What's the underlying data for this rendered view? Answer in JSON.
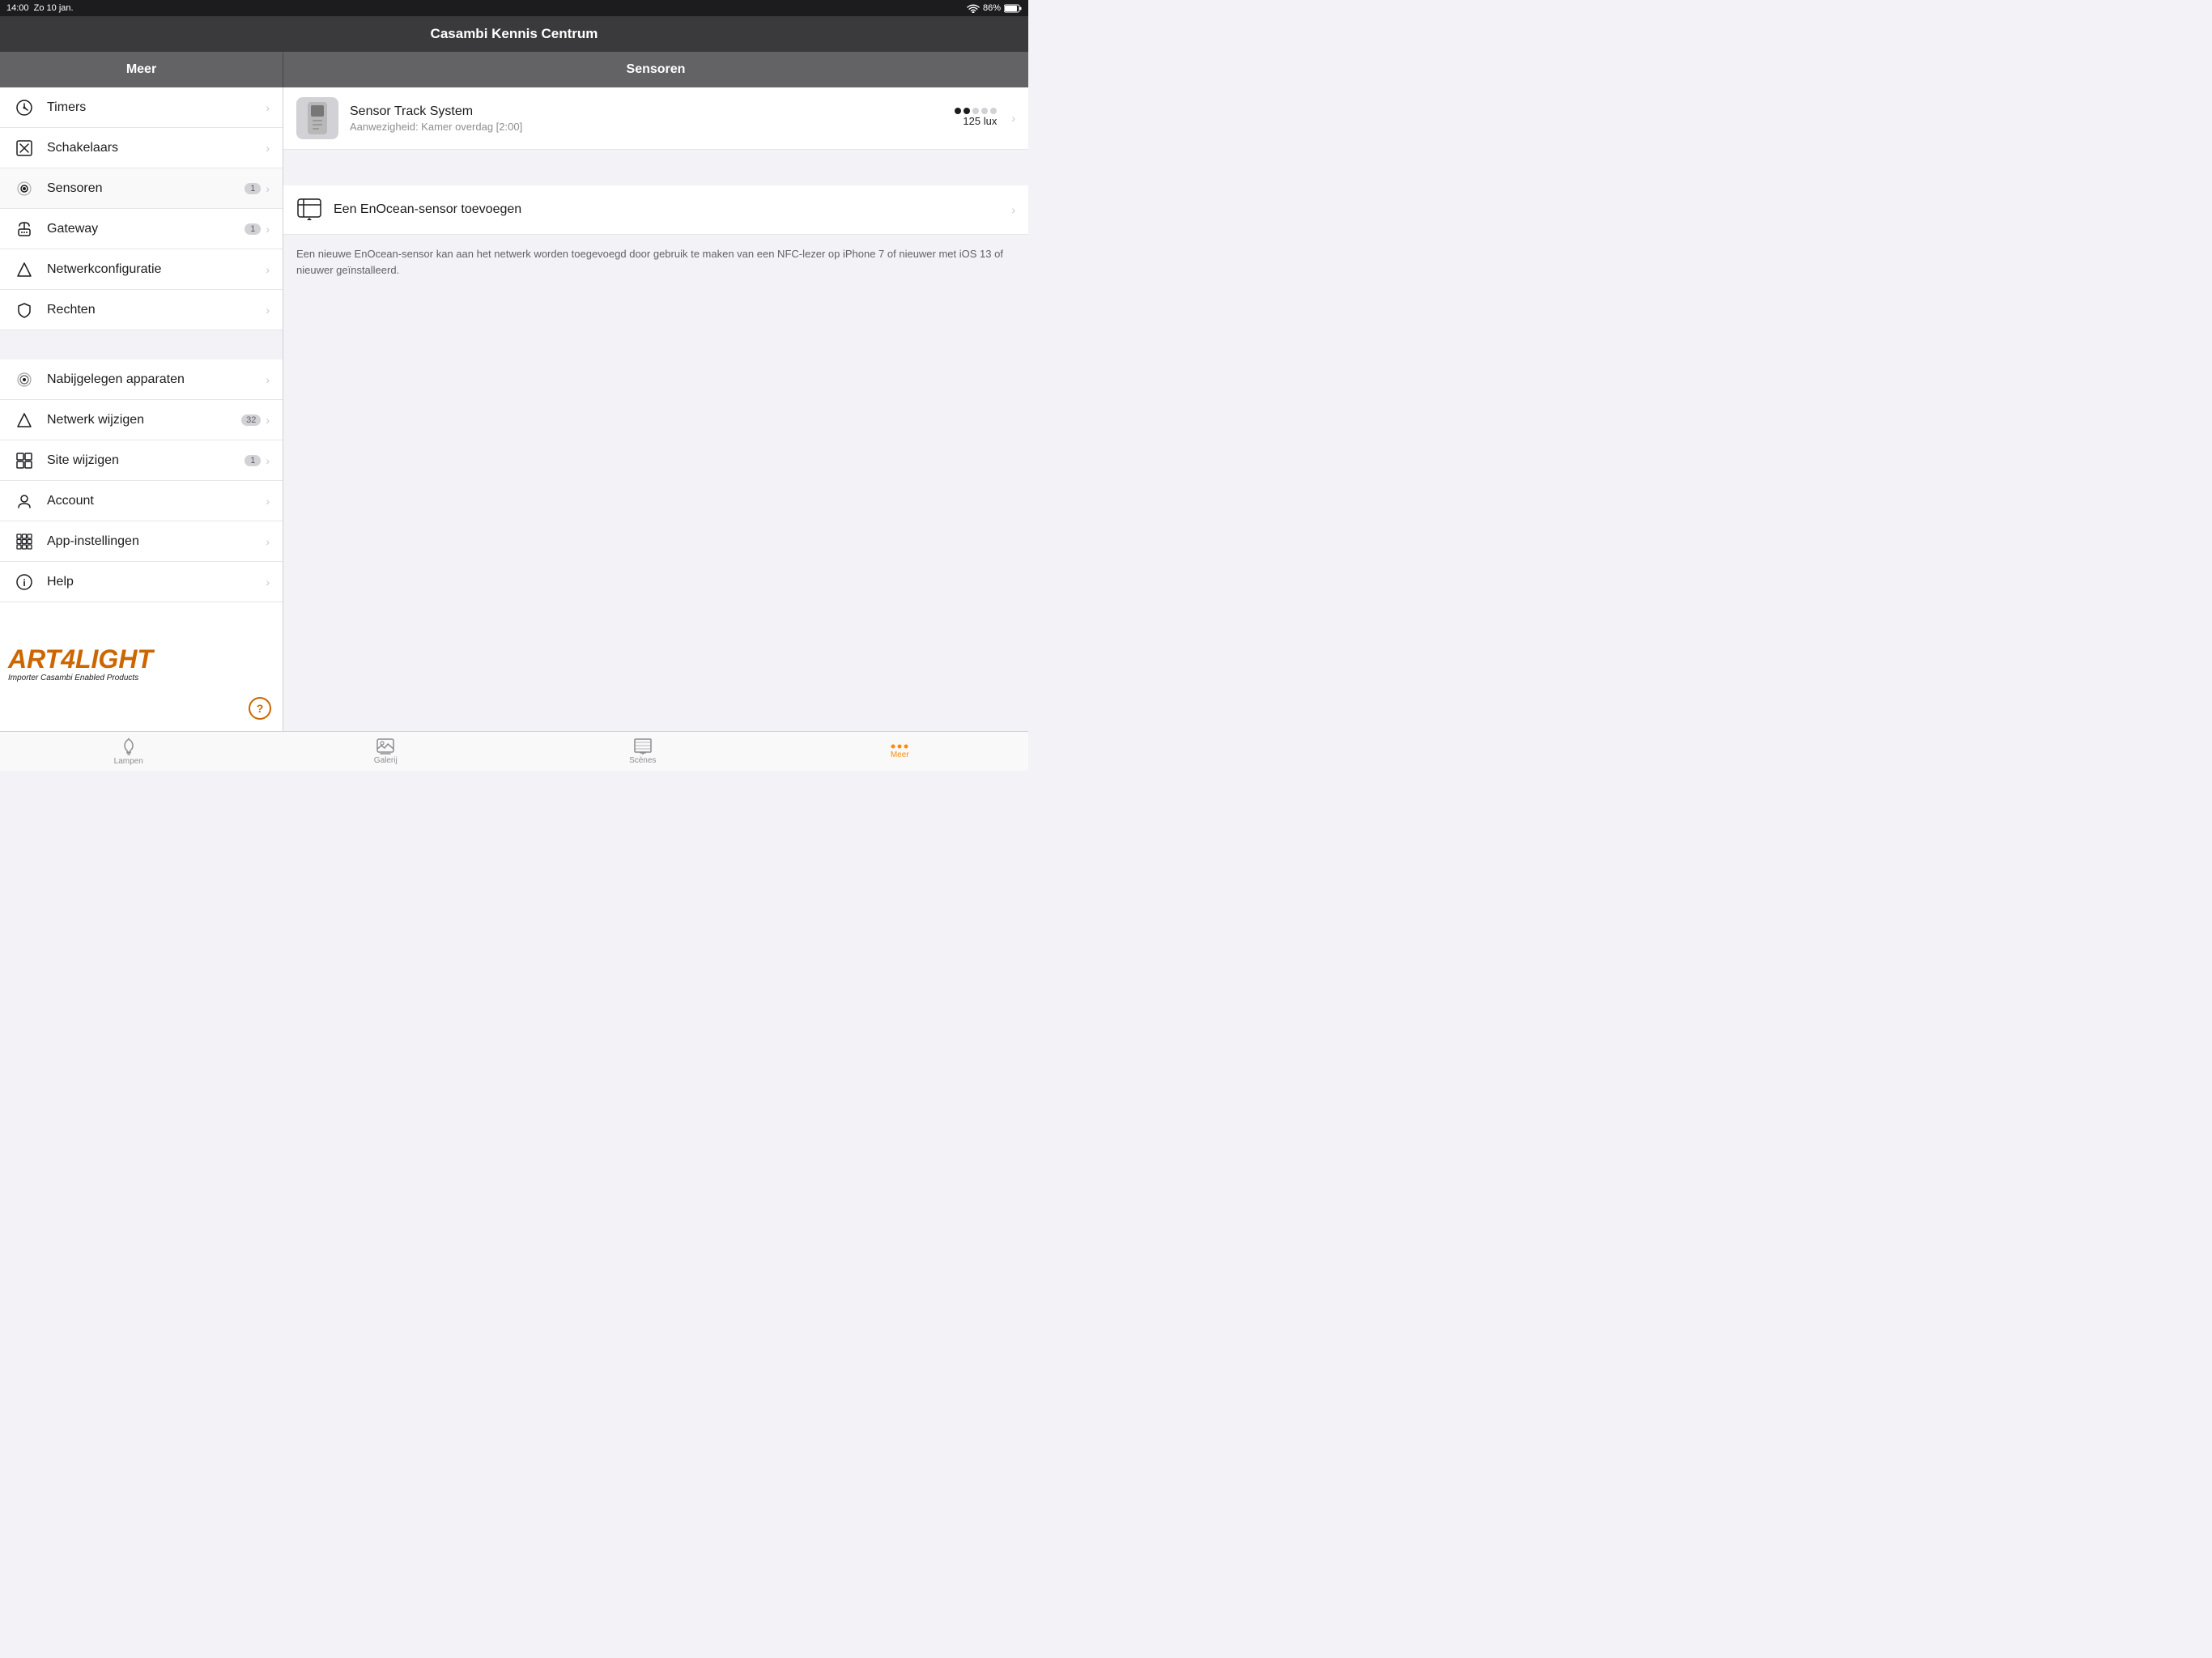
{
  "statusBar": {
    "time": "14:00",
    "date": "Zo 10 jan.",
    "battery": "86%",
    "wifi": "wifi"
  },
  "header": {
    "title": "Casambi Kennis Centrum"
  },
  "sidebar": {
    "title": "Meer",
    "items": [
      {
        "id": "timers",
        "label": "Timers",
        "icon": "clock",
        "badge": null
      },
      {
        "id": "schakelaars",
        "label": "Schakelaars",
        "icon": "switch",
        "badge": null
      },
      {
        "id": "sensoren",
        "label": "Sensoren",
        "icon": "sensor",
        "badge": "1"
      },
      {
        "id": "gateway",
        "label": "Gateway",
        "icon": "gateway",
        "badge": "1"
      },
      {
        "id": "netwerkconfiguratie",
        "label": "Netwerkconfiguratie",
        "icon": "network",
        "badge": null
      },
      {
        "id": "rechten",
        "label": "Rechten",
        "icon": "shield",
        "badge": null
      }
    ],
    "items2": [
      {
        "id": "nabijgelegen",
        "label": "Nabijgelegen apparaten",
        "icon": "radar",
        "badge": null
      },
      {
        "id": "netwerk-wijzigen",
        "label": "Netwerk wijzigen",
        "icon": "antenna",
        "badge": "32"
      },
      {
        "id": "site-wijzigen",
        "label": "Site wijzigen",
        "icon": "grid",
        "badge": "1"
      },
      {
        "id": "account",
        "label": "Account",
        "icon": "person",
        "badge": null
      },
      {
        "id": "app-instellingen",
        "label": "App-instellingen",
        "icon": "grid2",
        "badge": null
      },
      {
        "id": "help",
        "label": "Help",
        "icon": "info",
        "badge": null
      }
    ]
  },
  "rightPanel": {
    "title": "Sensoren",
    "sensor": {
      "name": "Sensor Track System",
      "description": "Aanwezigheid: Kamer overdag [2:00]",
      "dots": [
        true,
        true,
        false,
        false,
        false
      ],
      "value": "125 lux"
    },
    "addEnocean": {
      "label": "Een EnOcean-sensor toevoegen",
      "description": "Een nieuwe EnOcean-sensor kan aan het netwerk worden toegevoegd door gebruik te maken van een NFC-lezer op iPhone 7 of nieuwer met iOS 13 of nieuwer geïnstalleerd."
    }
  },
  "tabBar": {
    "tabs": [
      {
        "id": "lampen",
        "label": "Lampen",
        "icon": "lamp",
        "active": false
      },
      {
        "id": "galerij",
        "label": "Galerij",
        "icon": "gallery",
        "active": false
      },
      {
        "id": "scenes",
        "label": "Scènes",
        "icon": "scenes",
        "active": false
      },
      {
        "id": "meer",
        "label": "Meer",
        "icon": "more",
        "active": true
      }
    ]
  },
  "watermark": {
    "logo": "ART4LIGHT",
    "sub": "Importer Casambi Enabled Products"
  }
}
